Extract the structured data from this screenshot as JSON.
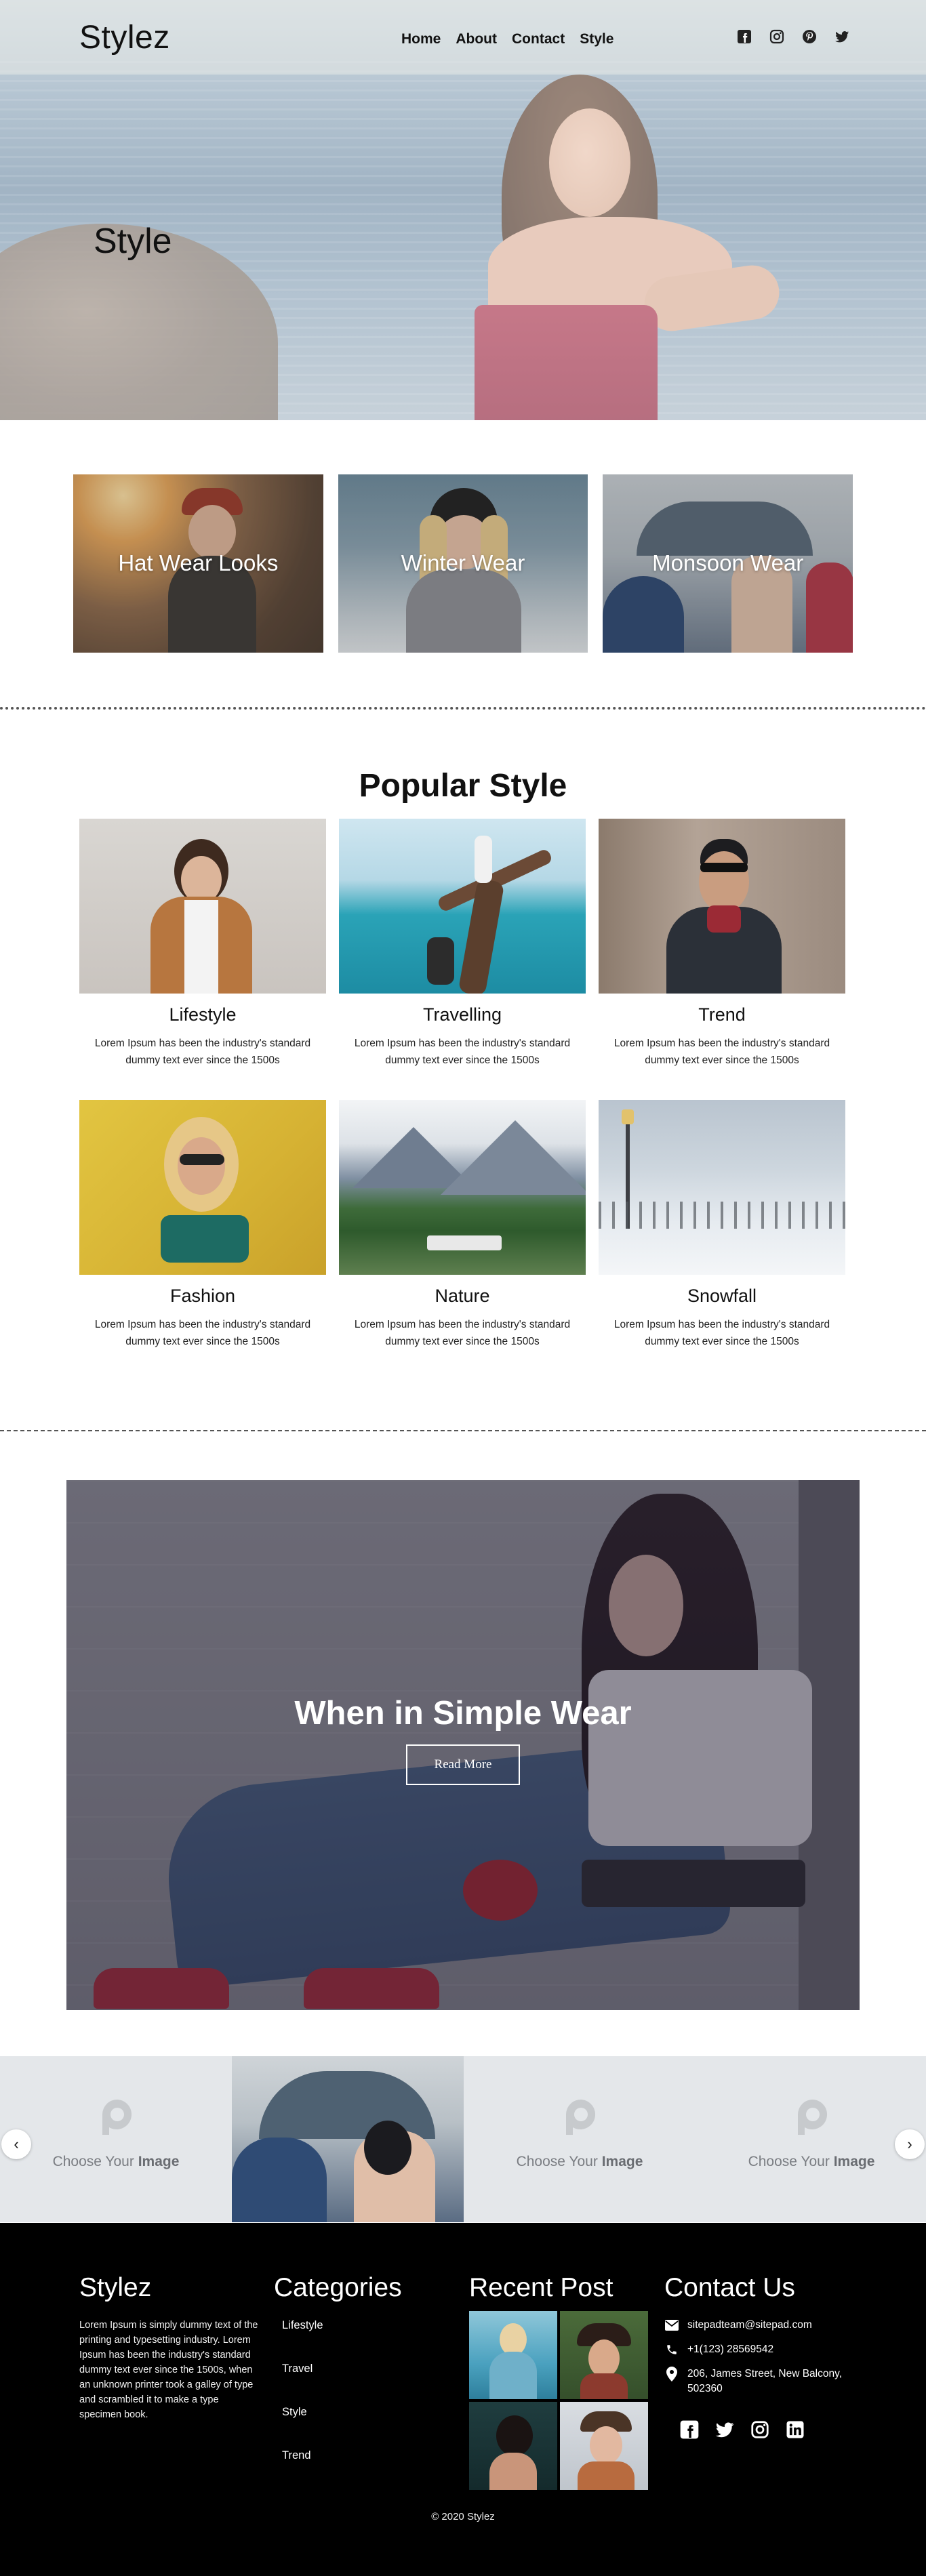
{
  "site": {
    "logo": "Stylez"
  },
  "nav": {
    "items": [
      "Home",
      "About",
      "Contact",
      "Style"
    ]
  },
  "social_top": [
    "facebook-square-icon",
    "instagram-icon",
    "pinterest-icon",
    "twitter-icon"
  ],
  "hero": {
    "title": "Style"
  },
  "categories": [
    {
      "label": "Hat Wear Looks"
    },
    {
      "label": "Winter Wear"
    },
    {
      "label": "Monsoon Wear"
    }
  ],
  "popular": {
    "title": "Popular Style",
    "items": [
      {
        "name": "Lifestyle",
        "desc": "Lorem Ipsum has been the industry's standard dummy text ever since the 1500s"
      },
      {
        "name": "Travelling",
        "desc": "Lorem Ipsum has been the industry's standard dummy text ever since the 1500s"
      },
      {
        "name": "Trend",
        "desc": "Lorem Ipsum has been the industry's standard dummy text ever since the 1500s"
      },
      {
        "name": "Fashion",
        "desc": "Lorem Ipsum has been the industry's standard dummy text ever since the 1500s"
      },
      {
        "name": "Nature",
        "desc": "Lorem Ipsum has been the industry's standard dummy text ever since the 1500s"
      },
      {
        "name": "Snowfall",
        "desc": "Lorem Ipsum has been the industry's standard dummy text ever since the 1500s"
      }
    ]
  },
  "banner": {
    "title": "When in Simple Wear",
    "button": "Read More"
  },
  "carousel": {
    "placeholder_prefix": "Choose  Your",
    "placeholder_bold": "Image",
    "prev": "‹",
    "next": "›"
  },
  "footer": {
    "about": {
      "title": "Stylez",
      "text": "Lorem Ipsum is simply dummy text of the printing and typesetting industry. Lorem Ipsum has been the industry's standard dummy text ever since the 1500s, when an unknown printer took a galley of type and scrambled it to make a type specimen book."
    },
    "categories": {
      "title": "Categories",
      "items": [
        "Lifestyle",
        "Travel",
        "Style",
        "Trend"
      ]
    },
    "recent": {
      "title": "Recent Post"
    },
    "contact": {
      "title": "Contact Us",
      "email": "sitepadteam@sitepad.com",
      "phone": "+1(123) 28569542",
      "address": "206, James Street, New Balcony, 502360"
    },
    "social": [
      "facebook-square-icon",
      "twitter-icon",
      "instagram-icon",
      "linkedin-icon"
    ],
    "copyright": "© 2020 Stylez"
  }
}
